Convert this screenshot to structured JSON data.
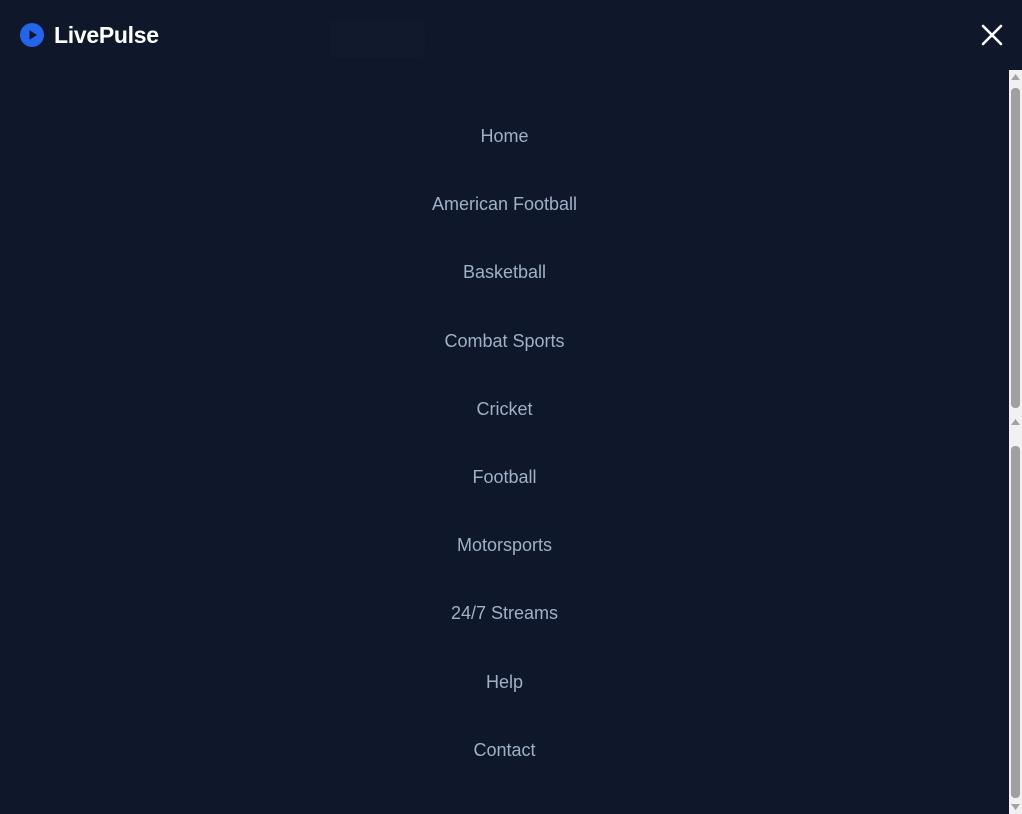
{
  "brand": {
    "name": "LivePulse",
    "icon": "play-circle-icon",
    "accent_color": "#2563eb"
  },
  "close_icon": "close-icon",
  "nav": {
    "items": [
      {
        "label": "Home"
      },
      {
        "label": "American Football"
      },
      {
        "label": "Basketball"
      },
      {
        "label": "Combat Sports"
      },
      {
        "label": "Cricket"
      },
      {
        "label": "Football"
      },
      {
        "label": "Motorsports"
      },
      {
        "label": "24/7 Streams"
      },
      {
        "label": "Help"
      },
      {
        "label": "Contact"
      }
    ]
  },
  "colors": {
    "background": "#0f172a",
    "nav_text": "#9fb0c8",
    "brand_text": "#ffffff"
  }
}
